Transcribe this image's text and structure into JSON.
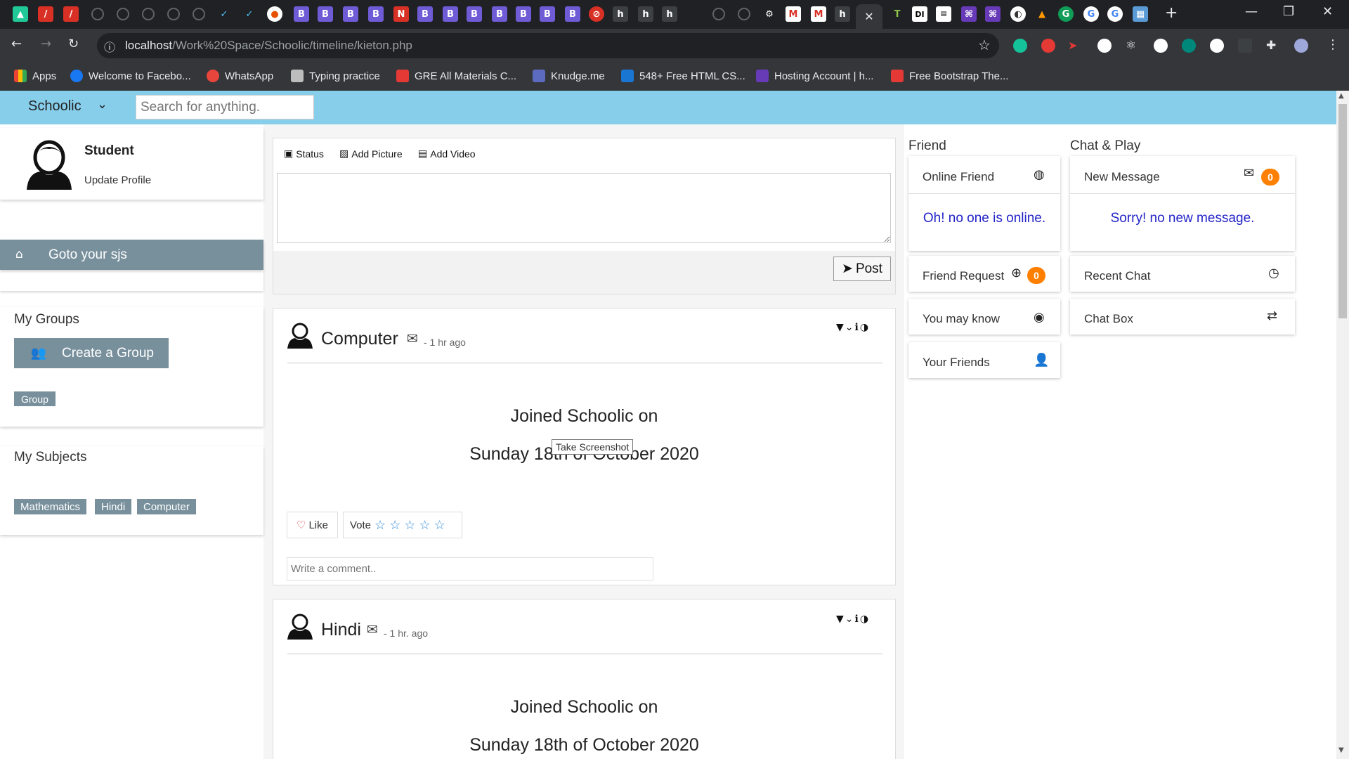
{
  "browser": {
    "url_host": "localhost",
    "url_path": "/Work%20Space/Schoolic/timeline/kieton.php",
    "bookmarks": [
      {
        "label": "Apps",
        "color": "#ea4335"
      },
      {
        "label": "Welcome to Facebo...",
        "color": "#1877f2"
      },
      {
        "label": "WhatsApp",
        "color": "#e8453c"
      },
      {
        "label": "Typing practice",
        "color": "#bdbdbd"
      },
      {
        "label": "GRE All Materials C...",
        "color": "#e53935"
      },
      {
        "label": "Knudge.me",
        "color": "#5c6bc0"
      },
      {
        "label": "548+ Free HTML CS...",
        "color": "#1976d2"
      },
      {
        "label": "Hosting Account | h...",
        "color": "#673ab7"
      },
      {
        "label": "Free Bootstrap The...",
        "color": "#e53935"
      }
    ]
  },
  "nav": {
    "brand": "Schoolic",
    "search_placeholder": "Search for anything."
  },
  "profile": {
    "name": "Student",
    "update_link": "Update Profile"
  },
  "sidebar": {
    "goto_label": "Goto your sjs",
    "groups_title": "My Groups",
    "create_group_label": "Create a Group",
    "group_tag": "Group",
    "subjects_title": "My Subjects",
    "subjects": [
      "Mathematics",
      "Hindi",
      "Computer"
    ]
  },
  "composer": {
    "tabs": [
      "Status",
      "Add Picture",
      "Add Video"
    ],
    "post_label": "Post"
  },
  "posts": [
    {
      "author": "Computer",
      "time": "- 1 hr ago",
      "line1": "Joined Schoolic on",
      "line2": "Sunday 18th of October 2020",
      "like_label": "Like",
      "vote_label": "Vote",
      "comment_placeholder": "Write a comment.."
    },
    {
      "author": "Hindi",
      "time": "- 1 hr. ago",
      "line1": "Joined Schoolic on",
      "line2": "Sunday 18th of October 2020"
    }
  ],
  "tooltip": "Take Screenshot",
  "friend_panel": {
    "title": "Friend",
    "online_friend": "Online Friend",
    "online_msg": "Oh! no one is online.",
    "friend_request": "Friend Request",
    "friend_request_count": "0",
    "you_may_know": "You may know",
    "your_friends": "Your Friends"
  },
  "chat_panel": {
    "title": "Chat & Play",
    "new_message": "New Message",
    "new_message_count": "0",
    "no_message_msg": "Sorry! no new message.",
    "recent_chat": "Recent Chat",
    "chat_box": "Chat Box"
  },
  "colors": {
    "navbar": "#87ceeb",
    "sidebar_button": "#78909c",
    "badge": "#ff7f00",
    "link_blue": "#2323c8"
  }
}
